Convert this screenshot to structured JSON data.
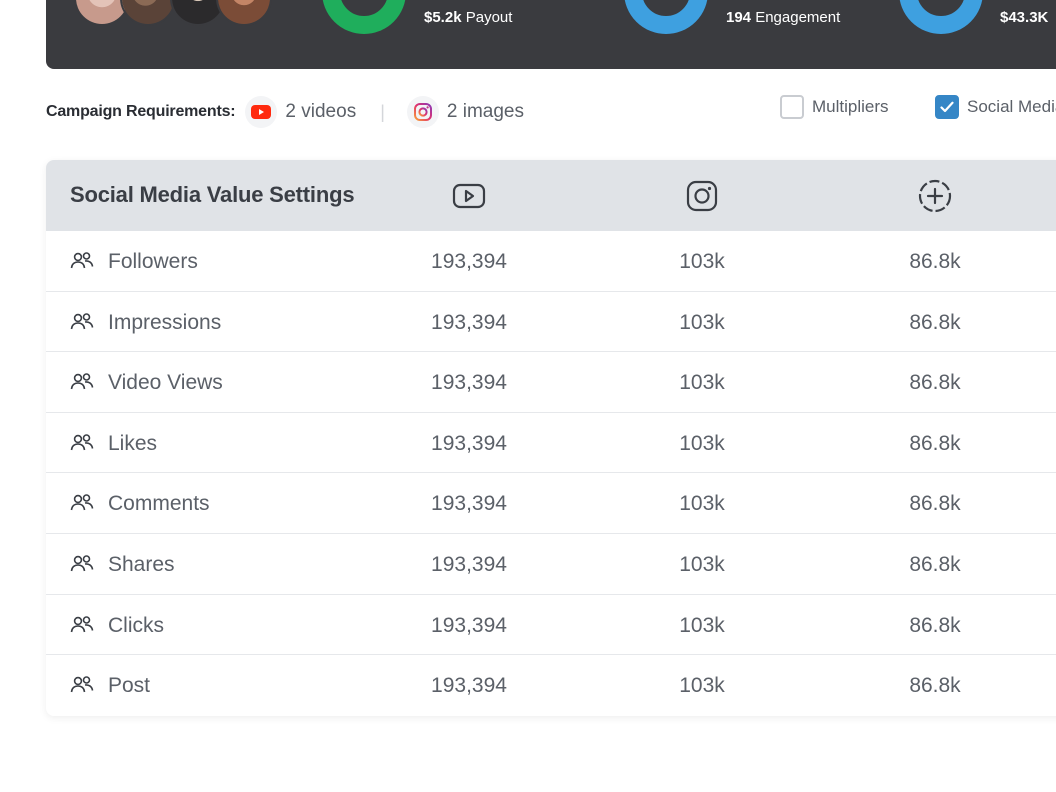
{
  "banner": {
    "stats": [
      {
        "value": "$5.2k",
        "label": "Payout"
      },
      {
        "value": "194",
        "label": "Engagement"
      },
      {
        "value": "$43.3K",
        "label": ""
      }
    ],
    "colors": {
      "background": "#3a3b3f",
      "donut_green": "#1fae5c",
      "donut_blue": "#3ea0e0"
    }
  },
  "requirements": {
    "title": "Campaign Requirements:",
    "items": [
      {
        "icon": "youtube-icon",
        "text": "2 videos"
      },
      {
        "icon": "instagram-icon",
        "text": "2 images"
      }
    ],
    "separator": "|"
  },
  "toggles": [
    {
      "label": "Multipliers",
      "checked": false
    },
    {
      "label": "Social Media",
      "checked": true
    }
  ],
  "table": {
    "title": "Social Media Value Settings",
    "columns": [
      {
        "icon": "youtube-outline-icon"
      },
      {
        "icon": "instagram-outline-icon"
      },
      {
        "icon": "add-platform-icon"
      }
    ],
    "rows": [
      {
        "label": "Followers",
        "values": [
          "193,394",
          "103k",
          "86.8k"
        ]
      },
      {
        "label": "Impressions",
        "values": [
          "193,394",
          "103k",
          "86.8k"
        ]
      },
      {
        "label": "Video Views",
        "values": [
          "193,394",
          "103k",
          "86.8k"
        ]
      },
      {
        "label": "Likes",
        "values": [
          "193,394",
          "103k",
          "86.8k"
        ]
      },
      {
        "label": "Comments",
        "values": [
          "193,394",
          "103k",
          "86.8k"
        ]
      },
      {
        "label": "Shares",
        "values": [
          "193,394",
          "103k",
          "86.8k"
        ]
      },
      {
        "label": "Clicks",
        "values": [
          "193,394",
          "103k",
          "86.8k"
        ]
      },
      {
        "label": "Post",
        "values": [
          "193,394",
          "103k",
          "86.8k"
        ]
      }
    ],
    "row_icon": "users-icon"
  }
}
